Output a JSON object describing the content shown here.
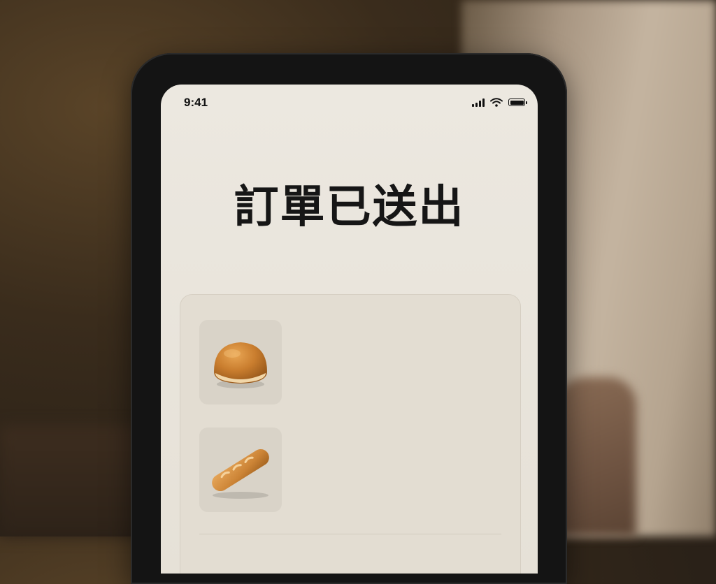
{
  "status_bar": {
    "time": "9:41",
    "icons": [
      "cellular-signal-icon",
      "wifi-icon",
      "battery-icon"
    ]
  },
  "screen": {
    "title": "訂單已送出"
  },
  "order": {
    "items": [
      {
        "image": "round-bread-roll"
      },
      {
        "image": "baguette"
      }
    ]
  },
  "colors": {
    "screen_background": "#ece8e0",
    "card_background": "#e3ddd2",
    "title_text": "#161616"
  }
}
